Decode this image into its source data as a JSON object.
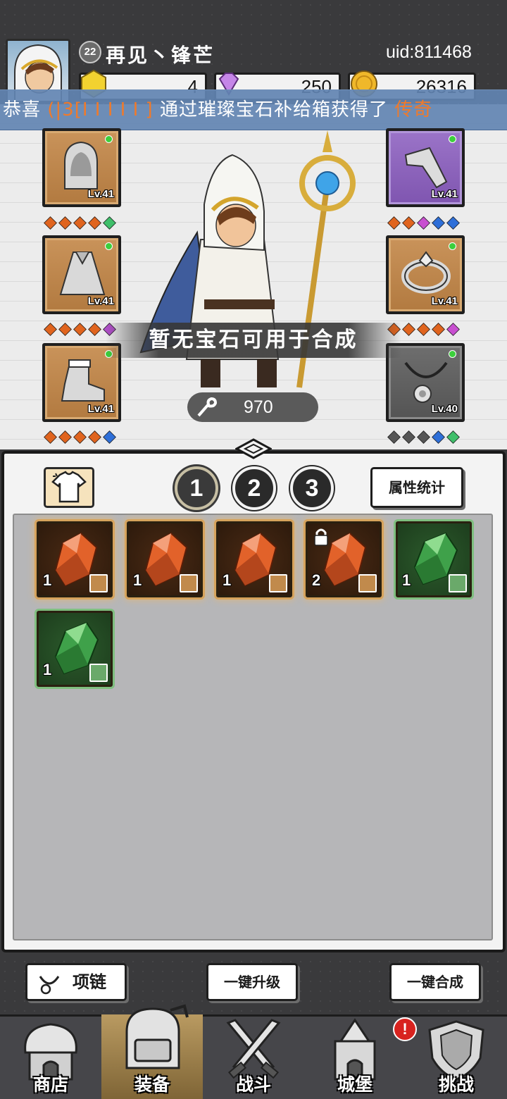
{
  "header": {
    "level": "22",
    "name": "再见丶锋芒",
    "uid": "uid:811468",
    "currencies": [
      {
        "icon": "gold-gem-icon",
        "value": "4"
      },
      {
        "icon": "purple-diamond-icon",
        "value": "250"
      },
      {
        "icon": "gold-coin-icon",
        "value": "26316"
      }
    ]
  },
  "notice": {
    "prefix": "恭喜",
    "player": "(|3[I I I I I ]",
    "middle": "通过璀璨宝石补给箱获得了",
    "reward": "传奇"
  },
  "equipment": {
    "left": [
      {
        "name": "hood",
        "level": "Lv.41",
        "frame": "brown",
        "gems": [
          "#e0641e",
          "#e0641e",
          "#e0641e",
          "#e0641e",
          "#3fbf6a"
        ]
      },
      {
        "name": "cape",
        "level": "Lv.41",
        "frame": "brown",
        "gems": [
          "#e0641e",
          "#e0641e",
          "#e0641e",
          "#e0641e",
          "#b04fc8"
        ]
      },
      {
        "name": "boots",
        "level": "Lv.41",
        "frame": "brown",
        "gems": [
          "#e0641e",
          "#e0641e",
          "#e0641e",
          "#e0641e",
          "#2e6fd8"
        ]
      }
    ],
    "right": [
      {
        "name": "bracer",
        "level": "Lv.41",
        "frame": "purple",
        "gems": [
          "#e0641e",
          "#e0641e",
          "#c84fd0",
          "#2e6fd8",
          "#2e6fd8"
        ]
      },
      {
        "name": "ring",
        "level": "Lv.41",
        "frame": "brown",
        "gems": [
          "#e0641e",
          "#e0641e",
          "#e0641e",
          "#e0641e",
          "#c84fd0"
        ]
      },
      {
        "name": "necklace",
        "level": "Lv.40",
        "frame": "grey",
        "gems": [
          "#555555",
          "#555555",
          "#555555",
          "#2e6fd8",
          "#3fbf6a"
        ]
      }
    ]
  },
  "banner": "暂无宝石可用于合成",
  "power": "970",
  "inventory": {
    "pages": [
      "1",
      "2",
      "3"
    ],
    "active_page": "1",
    "stats_label": "属性统计",
    "items": [
      {
        "color": "orange",
        "qty": "1",
        "locked": false
      },
      {
        "color": "orange",
        "qty": "1",
        "locked": false
      },
      {
        "color": "orange",
        "qty": "1",
        "locked": false
      },
      {
        "color": "orange",
        "qty": "2",
        "locked": true
      },
      {
        "color": "green",
        "qty": "1",
        "locked": false
      },
      {
        "color": "green",
        "qty": "1",
        "locked": false
      }
    ]
  },
  "actions": {
    "necklace": "项链",
    "upgrade_all": "一键升级",
    "merge_all": "一键合成"
  },
  "nav": {
    "items": [
      {
        "label": "商店",
        "icon": "shop-icon"
      },
      {
        "label": "装备",
        "icon": "backpack-icon"
      },
      {
        "label": "战斗",
        "icon": "crossed-swords-icon"
      },
      {
        "label": "城堡",
        "icon": "castle-icon"
      },
      {
        "label": "挑战",
        "icon": "shield-icon"
      }
    ],
    "active": "装备",
    "alert": "!"
  },
  "colors": {
    "notice_bg": "#6284b2",
    "reward_text": "#f07a2a",
    "active_nav": "#b99a61"
  }
}
